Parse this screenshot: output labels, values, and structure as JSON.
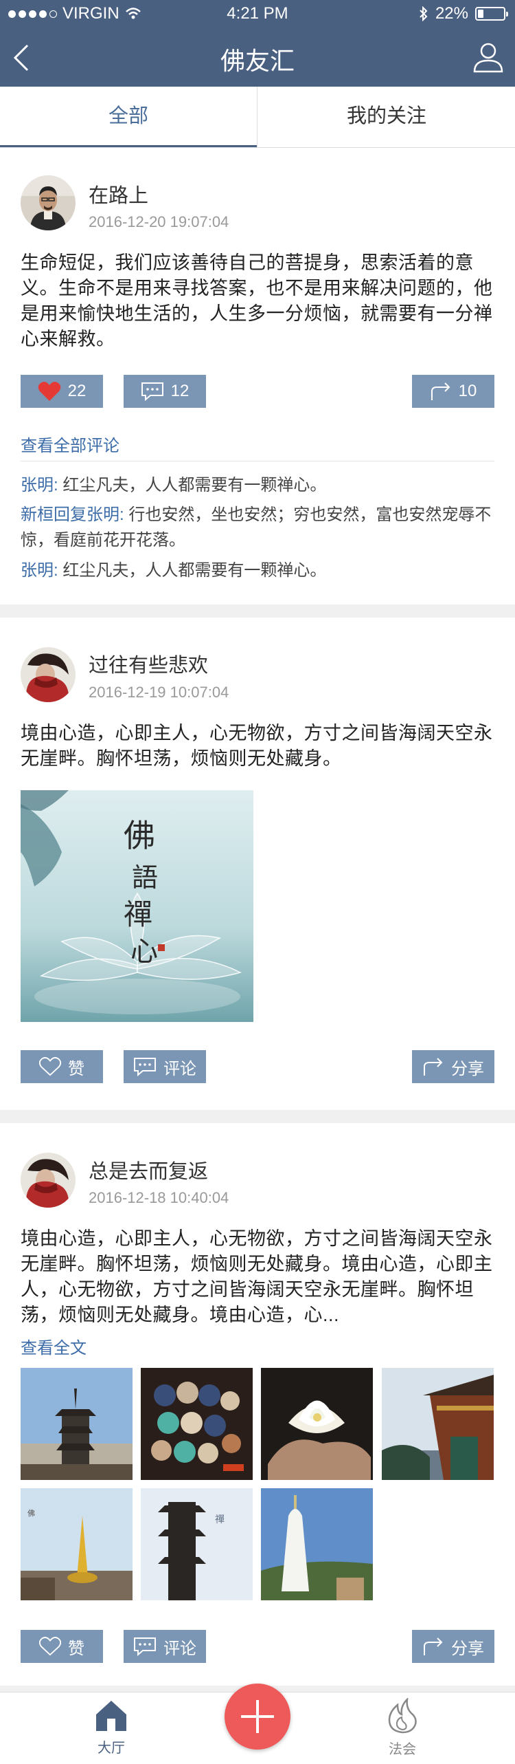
{
  "status_bar": {
    "carrier": "VIRGIN",
    "time": "4:21 PM",
    "battery": "22%",
    "battery_level": 0.22
  },
  "navbar": {
    "title": "佛友汇"
  },
  "tabs": [
    {
      "label": "全部",
      "active": true
    },
    {
      "label": "我的关注",
      "active": false
    }
  ],
  "posts": [
    {
      "author": "在路上",
      "date": "2016-12-20 19:07:04",
      "content": "生命短促，我们应该善待自己的菩提身，思索活着的意义。生命不是用来寻找答案，也不是用来解决问题的，他是用来愉快地生活的，人生多一分烦恼，就需要有一分禅心来解救。",
      "likes": "22",
      "comments_count": "12",
      "shares": "10",
      "view_all_comments": "查看全部评论",
      "comments": [
        {
          "name": "张明:",
          "text": " 红尘凡夫，人人都需要有一颗禅心。"
        },
        {
          "name": "新桓回复张明:",
          "text": " 行也安然，坐也安然；穷也安然，富也安然宠辱不惊，看庭前花开花落。"
        },
        {
          "name": "张明:",
          "text": " 红尘凡夫，人人都需要有一颗禅心。"
        }
      ]
    },
    {
      "author": "过往有些悲欢",
      "date": "2016-12-19 10:07:04",
      "content": "境由心造，心即主人，心无物欲，方寸之间皆海阔天空永无崖畔。胸怀坦荡，烦恼则无处藏身。",
      "image_text": "佛語禪心",
      "like_label": "赞",
      "comment_label": "评论",
      "share_label": "分享"
    },
    {
      "author": "总是去而复返",
      "date": "2016-12-18 10:40:04",
      "content": "境由心造，心即主人，心无物欲，方寸之间皆海阔天空永无崖畔。胸怀坦荡，烦恼则无处藏身。境由心造，心即主人，心无物欲，方寸之间皆海阔天空永无崖畔。胸怀坦荡，烦恼则无处藏身。境由心造，心...",
      "read_more": "查看全文",
      "like_label": "赞",
      "comment_label": "评论",
      "share_label": "分享"
    }
  ],
  "bottom_nav": {
    "home_label": "大厅",
    "fahui_label": "法会"
  },
  "colors": {
    "nav": "#4a6080",
    "button": "#7b96b4",
    "link": "#3d6da8",
    "fab": "#ee5a5a",
    "like": "#e53935"
  }
}
